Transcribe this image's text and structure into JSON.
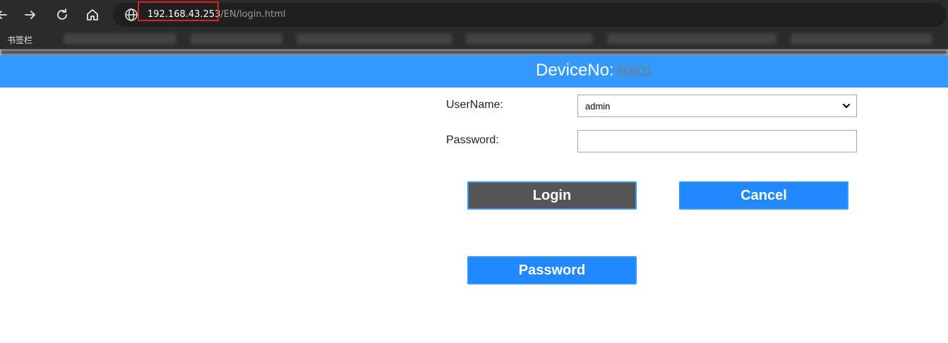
{
  "browser": {
    "url_host": "192.168.43.253",
    "url_path": "/EN/login.html",
    "bookmarks_label": "书签栏"
  },
  "header": {
    "device_label": "DeviceNo:",
    "device_number": "50001"
  },
  "form": {
    "username_label": "UserName:",
    "username_value": "admin",
    "password_label": "Password:",
    "password_value": ""
  },
  "buttons": {
    "login": "Login",
    "cancel": "Cancel",
    "password": "Password"
  },
  "colors": {
    "header": "#3399ff",
    "button_blue": "#2288ff",
    "button_gray": "#555555",
    "highlight": "#e02020"
  }
}
